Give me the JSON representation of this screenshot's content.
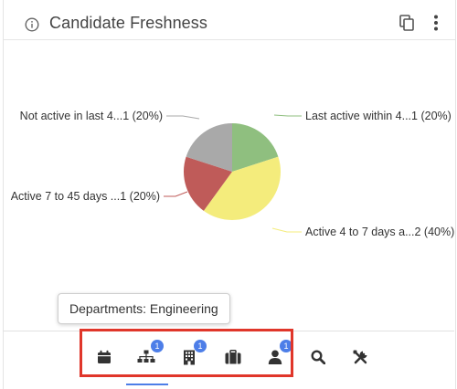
{
  "header": {
    "title": "Candidate Freshness"
  },
  "chart_data": {
    "type": "pie",
    "title": "Candidate Freshness",
    "slices": [
      {
        "label": "Last active within 4...1 (20%)",
        "value": 1,
        "percent": 20,
        "color": "#8fbf7f"
      },
      {
        "label": "Active 4 to 7 days a...2 (40%)",
        "value": 2,
        "percent": 40,
        "color": "#f4ec7c"
      },
      {
        "label": "Active 7 to 45 days ...1 (20%)",
        "value": 1,
        "percent": 20,
        "color": "#bf5b59"
      },
      {
        "label": "Not active in last 4...1 (20%)",
        "value": 1,
        "percent": 20,
        "color": "#a9a9a9"
      }
    ],
    "start_angle": "12 o'clock",
    "direction": "clockwise",
    "legend": "none"
  },
  "tooltip": {
    "text": "Departments: Engineering"
  },
  "toolbar": {
    "buttons": [
      {
        "name": "calendar-button",
        "icon": "calendar-icon",
        "badge": ""
      },
      {
        "name": "departments-button",
        "icon": "org-chart-icon",
        "badge": "1"
      },
      {
        "name": "offices-button",
        "icon": "building-icon",
        "badge": "1"
      },
      {
        "name": "jobs-button",
        "icon": "briefcase-icon",
        "badge": ""
      },
      {
        "name": "users-button",
        "icon": "person-icon",
        "badge": "1"
      },
      {
        "name": "search-button",
        "icon": "search-icon",
        "badge": ""
      },
      {
        "name": "tools-button",
        "icon": "tools-icon",
        "badge": ""
      }
    ],
    "highlight_color": "#e0362a",
    "badge_color": "#4d7ee8"
  }
}
